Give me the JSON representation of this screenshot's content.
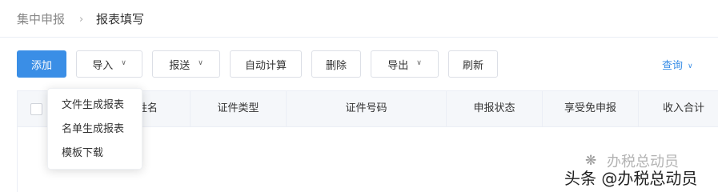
{
  "breadcrumb": {
    "home": "集中申报",
    "separator": "›",
    "current": "报表填写"
  },
  "toolbar": {
    "add": "添加",
    "import": "导入",
    "submit": "报送",
    "auto_calc": "自动计算",
    "delete": "删除",
    "export": "导出",
    "refresh": "刷新",
    "query": "查询"
  },
  "import_menu": {
    "items": [
      "文件生成报表",
      "名单生成报表",
      "模板下载"
    ]
  },
  "table": {
    "columns": [
      "姓名",
      "证件类型",
      "证件号码",
      "申报状态",
      "享受免申报",
      "收入合计"
    ]
  },
  "watermark": {
    "top": "办税总动员",
    "line": "头条 @办税总动员"
  },
  "colors": {
    "primary": "#3a8ee6",
    "header_bg": "#f5f7fa",
    "border": "#ebeef5"
  }
}
